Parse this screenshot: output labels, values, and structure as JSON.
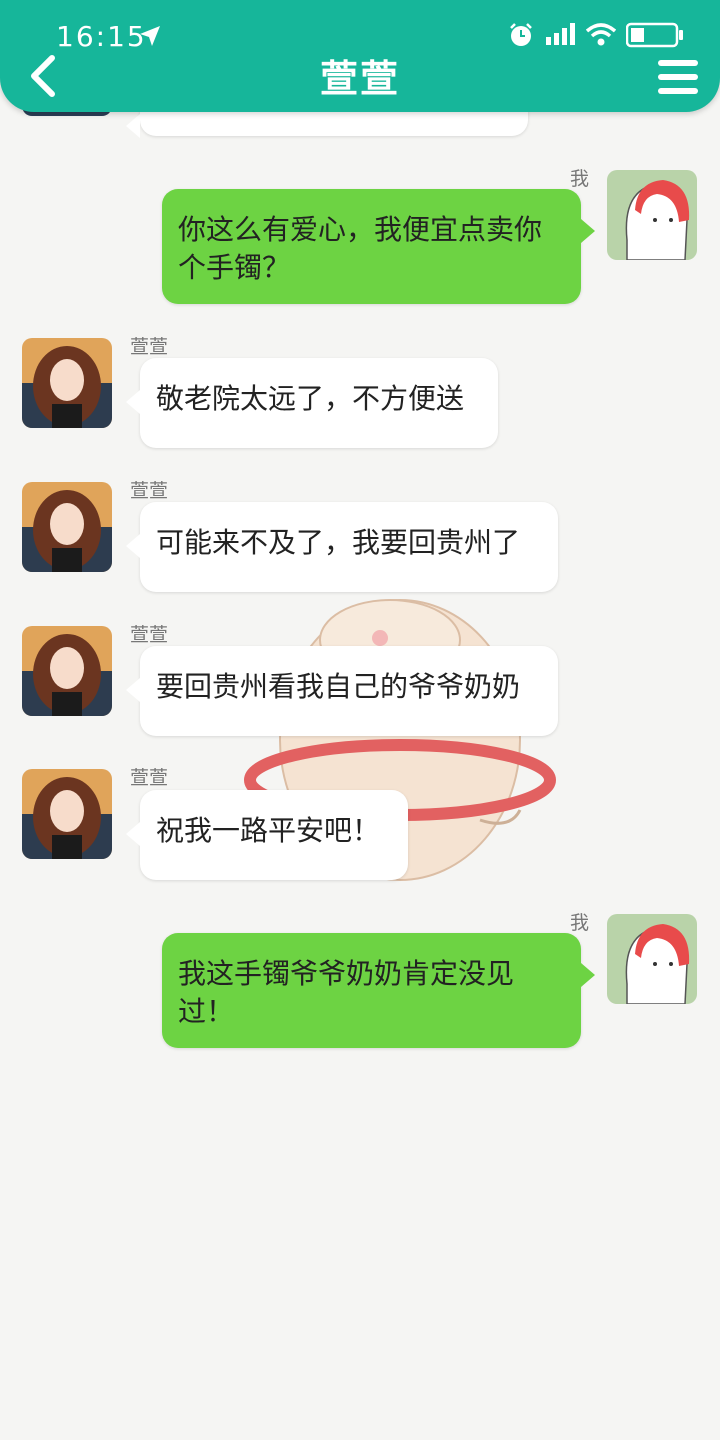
{
  "status_bar": {
    "time": "16:15"
  },
  "header": {
    "title": "萱萱"
  },
  "messages": [
    {
      "side": "left",
      "sender": "",
      "text": ""
    },
    {
      "side": "right",
      "sender": "我",
      "text": "你这么有爱心，我便宜点卖你个手镯？"
    },
    {
      "side": "left",
      "sender": "萱萱",
      "text": "敬老院太远了，不方便送"
    },
    {
      "side": "left",
      "sender": "萱萱",
      "text": "可能来不及了，我要回贵州了"
    },
    {
      "side": "left",
      "sender": "萱萱",
      "text": "要回贵州看我自己的爷爷奶奶"
    },
    {
      "side": "left",
      "sender": "萱萱",
      "text": "祝我一路平安吧！"
    },
    {
      "side": "right",
      "sender": "我",
      "text": "我这手镯爷爷奶奶肯定没见过！"
    }
  ],
  "colors": {
    "header": "#16b69a",
    "bubble_me": "#6dd343",
    "bubble_other": "#ffffff",
    "background": "#f5f5f3"
  }
}
